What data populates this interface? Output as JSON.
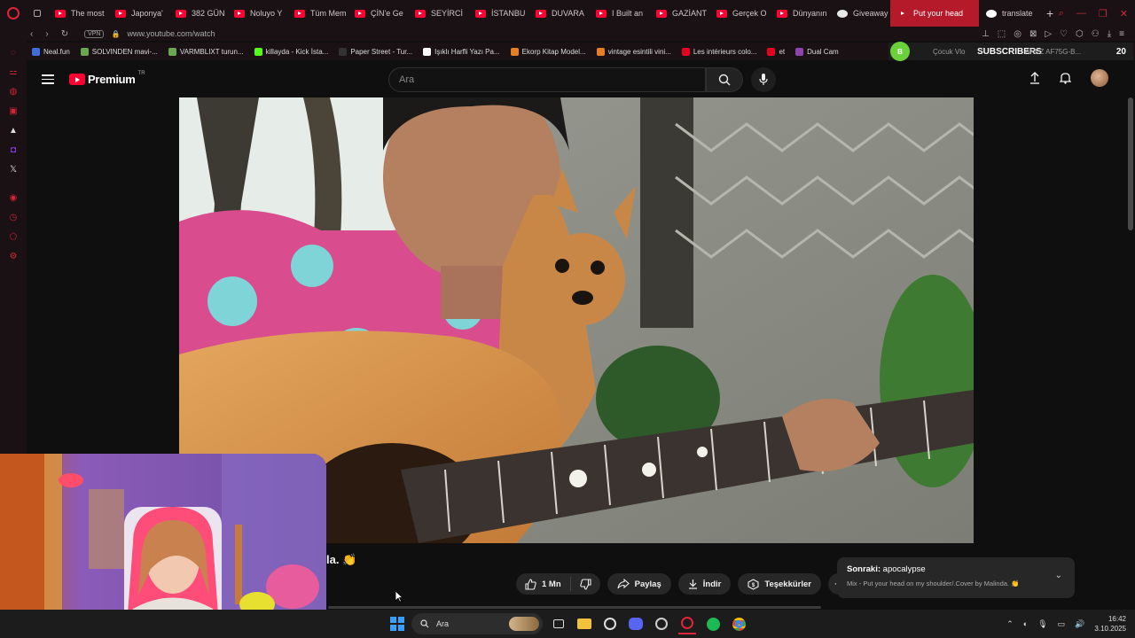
{
  "browser": {
    "tabs": [
      {
        "label": "The most",
        "icon": "youtube-icon"
      },
      {
        "label": "Japonya'",
        "icon": "youtube-icon"
      },
      {
        "label": "382 GÜN",
        "icon": "youtube-icon"
      },
      {
        "label": "Noluyo Y",
        "icon": "youtube-icon"
      },
      {
        "label": "Tüm Mem",
        "icon": "youtube-icon"
      },
      {
        "label": "ÇİN'e Ge",
        "icon": "youtube-icon"
      },
      {
        "label": "SEYİRCİ",
        "icon": "youtube-icon"
      },
      {
        "label": "İSTANBU",
        "icon": "youtube-icon"
      },
      {
        "label": "DUVARA",
        "icon": "youtube-icon"
      },
      {
        "label": "I Built an",
        "icon": "youtube-icon"
      },
      {
        "label": "GAZİANT",
        "icon": "youtube-icon"
      },
      {
        "label": "Gerçek O",
        "icon": "youtube-icon"
      },
      {
        "label": "Dünyanın",
        "icon": "youtube-icon"
      },
      {
        "label": "Giveaway",
        "icon": "giveaway-icon"
      },
      {
        "label": "Put your head",
        "icon": "speaker-icon",
        "active": true
      },
      {
        "label": "translate",
        "icon": "google-icon"
      }
    ],
    "new_tab": "+",
    "vpn": "VPN",
    "url": "www.youtube.com/watch",
    "bookmarks": [
      {
        "label": "Neal.fun",
        "color": "#3e6fd8"
      },
      {
        "label": "SOLVINDEN mavi-...",
        "color": "#6aa84f"
      },
      {
        "label": "VARMBLIXT turun...",
        "color": "#6aa84f"
      },
      {
        "label": "killayda - Kick İsta...",
        "color": "#53fc18"
      },
      {
        "label": "Paper Street - Tur...",
        "color": "#333333"
      },
      {
        "label": "Işıklı Harfli Yazı Pa...",
        "color": "#ffffff"
      },
      {
        "label": "Ekorp Kitap Model...",
        "color": "#e67e22"
      },
      {
        "label": "vintage esintili vini...",
        "color": "#e67e22"
      },
      {
        "label": "Les intérieurs colo...",
        "color": "#e60023"
      },
      {
        "label": "et",
        "color": "#e60023"
      },
      {
        "label": "Dual Cam",
        "color": "#8e44ad"
      }
    ],
    "subscribers_widget": {
      "badge": "B",
      "label": "SUBSCRIBERS",
      "count": "20",
      "behind_text": "Çocuk Vlo",
      "behind_text2": "ANEZ AF75G-B..."
    }
  },
  "youtube": {
    "logo_text": "Premium",
    "country_code": "TR",
    "search_placeholder": "Ara",
    "video_title_fragment": "la. 👏",
    "actions": {
      "like_count": "1 Mn",
      "share": "Paylaş",
      "download": "İndir",
      "thanks": "Teşekkürler",
      "more": "···"
    },
    "next": {
      "label": "Sonraki:",
      "title": "apocalypse",
      "subtitle": "Mix - Put your head on my shoulder/.Cover by Malinda. 👏"
    }
  },
  "taskbar": {
    "search_placeholder": "Ara",
    "time": "16:42",
    "date": "3.10.2025"
  }
}
